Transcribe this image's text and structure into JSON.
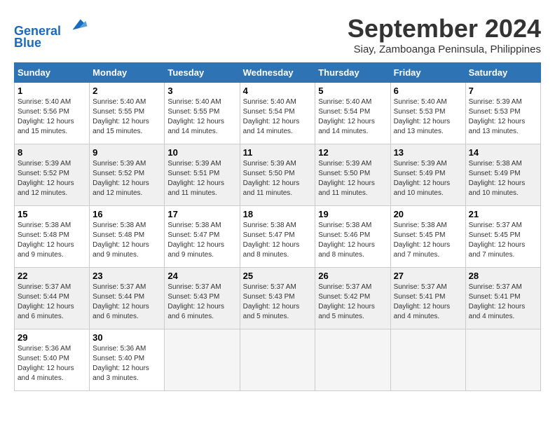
{
  "header": {
    "logo_line1": "General",
    "logo_line2": "Blue",
    "month": "September 2024",
    "location": "Siay, Zamboanga Peninsula, Philippines"
  },
  "weekdays": [
    "Sunday",
    "Monday",
    "Tuesday",
    "Wednesday",
    "Thursday",
    "Friday",
    "Saturday"
  ],
  "weeks": [
    [
      {
        "day": "1",
        "sunrise": "5:40 AM",
        "sunset": "5:56 PM",
        "daylight": "12 hours and 15 minutes."
      },
      {
        "day": "2",
        "sunrise": "5:40 AM",
        "sunset": "5:55 PM",
        "daylight": "12 hours and 15 minutes."
      },
      {
        "day": "3",
        "sunrise": "5:40 AM",
        "sunset": "5:55 PM",
        "daylight": "12 hours and 14 minutes."
      },
      {
        "day": "4",
        "sunrise": "5:40 AM",
        "sunset": "5:54 PM",
        "daylight": "12 hours and 14 minutes."
      },
      {
        "day": "5",
        "sunrise": "5:40 AM",
        "sunset": "5:54 PM",
        "daylight": "12 hours and 14 minutes."
      },
      {
        "day": "6",
        "sunrise": "5:40 AM",
        "sunset": "5:53 PM",
        "daylight": "12 hours and 13 minutes."
      },
      {
        "day": "7",
        "sunrise": "5:39 AM",
        "sunset": "5:53 PM",
        "daylight": "12 hours and 13 minutes."
      }
    ],
    [
      {
        "day": "8",
        "sunrise": "5:39 AM",
        "sunset": "5:52 PM",
        "daylight": "12 hours and 12 minutes."
      },
      {
        "day": "9",
        "sunrise": "5:39 AM",
        "sunset": "5:52 PM",
        "daylight": "12 hours and 12 minutes."
      },
      {
        "day": "10",
        "sunrise": "5:39 AM",
        "sunset": "5:51 PM",
        "daylight": "12 hours and 11 minutes."
      },
      {
        "day": "11",
        "sunrise": "5:39 AM",
        "sunset": "5:50 PM",
        "daylight": "12 hours and 11 minutes."
      },
      {
        "day": "12",
        "sunrise": "5:39 AM",
        "sunset": "5:50 PM",
        "daylight": "12 hours and 11 minutes."
      },
      {
        "day": "13",
        "sunrise": "5:39 AM",
        "sunset": "5:49 PM",
        "daylight": "12 hours and 10 minutes."
      },
      {
        "day": "14",
        "sunrise": "5:38 AM",
        "sunset": "5:49 PM",
        "daylight": "12 hours and 10 minutes."
      }
    ],
    [
      {
        "day": "15",
        "sunrise": "5:38 AM",
        "sunset": "5:48 PM",
        "daylight": "12 hours and 9 minutes."
      },
      {
        "day": "16",
        "sunrise": "5:38 AM",
        "sunset": "5:48 PM",
        "daylight": "12 hours and 9 minutes."
      },
      {
        "day": "17",
        "sunrise": "5:38 AM",
        "sunset": "5:47 PM",
        "daylight": "12 hours and 9 minutes."
      },
      {
        "day": "18",
        "sunrise": "5:38 AM",
        "sunset": "5:47 PM",
        "daylight": "12 hours and 8 minutes."
      },
      {
        "day": "19",
        "sunrise": "5:38 AM",
        "sunset": "5:46 PM",
        "daylight": "12 hours and 8 minutes."
      },
      {
        "day": "20",
        "sunrise": "5:38 AM",
        "sunset": "5:45 PM",
        "daylight": "12 hours and 7 minutes."
      },
      {
        "day": "21",
        "sunrise": "5:37 AM",
        "sunset": "5:45 PM",
        "daylight": "12 hours and 7 minutes."
      }
    ],
    [
      {
        "day": "22",
        "sunrise": "5:37 AM",
        "sunset": "5:44 PM",
        "daylight": "12 hours and 6 minutes."
      },
      {
        "day": "23",
        "sunrise": "5:37 AM",
        "sunset": "5:44 PM",
        "daylight": "12 hours and 6 minutes."
      },
      {
        "day": "24",
        "sunrise": "5:37 AM",
        "sunset": "5:43 PM",
        "daylight": "12 hours and 6 minutes."
      },
      {
        "day": "25",
        "sunrise": "5:37 AM",
        "sunset": "5:43 PM",
        "daylight": "12 hours and 5 minutes."
      },
      {
        "day": "26",
        "sunrise": "5:37 AM",
        "sunset": "5:42 PM",
        "daylight": "12 hours and 5 minutes."
      },
      {
        "day": "27",
        "sunrise": "5:37 AM",
        "sunset": "5:41 PM",
        "daylight": "12 hours and 4 minutes."
      },
      {
        "day": "28",
        "sunrise": "5:37 AM",
        "sunset": "5:41 PM",
        "daylight": "12 hours and 4 minutes."
      }
    ],
    [
      {
        "day": "29",
        "sunrise": "5:36 AM",
        "sunset": "5:40 PM",
        "daylight": "12 hours and 4 minutes."
      },
      {
        "day": "30",
        "sunrise": "5:36 AM",
        "sunset": "5:40 PM",
        "daylight": "12 hours and 3 minutes."
      },
      null,
      null,
      null,
      null,
      null
    ]
  ]
}
